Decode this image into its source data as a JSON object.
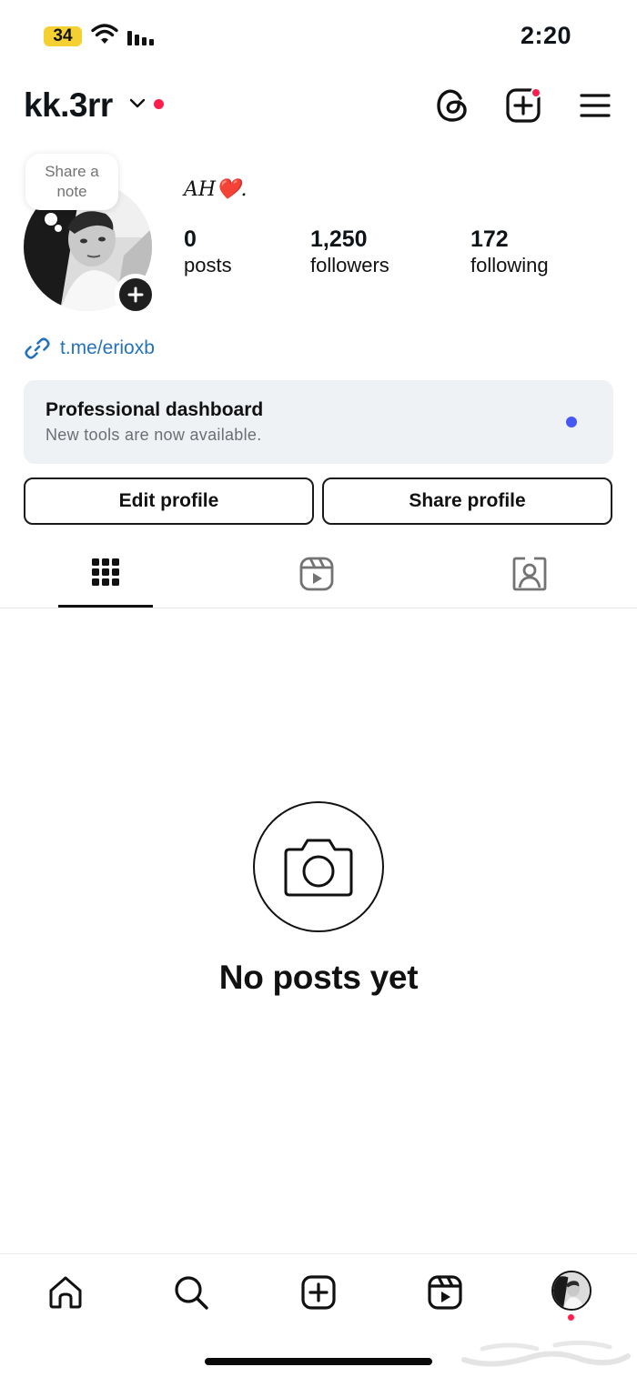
{
  "status_bar": {
    "battery": "34",
    "time": "2:20"
  },
  "header": {
    "username": "kk.3rr"
  },
  "profile": {
    "note_prompt": "Share a note",
    "display_name": "𝐴𝐻❤️.",
    "stats": {
      "posts_count": "0",
      "posts_label": "posts",
      "followers_count": "1,250",
      "followers_label": "followers",
      "following_count": "172",
      "following_label": "following"
    },
    "link": "t.me/erioxb"
  },
  "dashboard": {
    "title": "Professional dashboard",
    "subtitle": "New tools are now available."
  },
  "actions": {
    "edit_label": "Edit profile",
    "share_label": "Share profile"
  },
  "tabs": {
    "active": "grid",
    "items": [
      "grid-icon",
      "reels-icon",
      "tagged-icon"
    ]
  },
  "empty_state": {
    "title": "No posts yet"
  },
  "bottom_nav": {
    "items": [
      "home-icon",
      "search-icon",
      "create-icon",
      "reels-icon",
      "profile-avatar"
    ],
    "active": "profile-avatar"
  },
  "colors": {
    "notification_dot": "#ff1e4b",
    "link": "#2472b8",
    "dashboard_bg": "#eff2f5",
    "dashboard_dot": "#4658f4",
    "battery": "#f5d032"
  }
}
